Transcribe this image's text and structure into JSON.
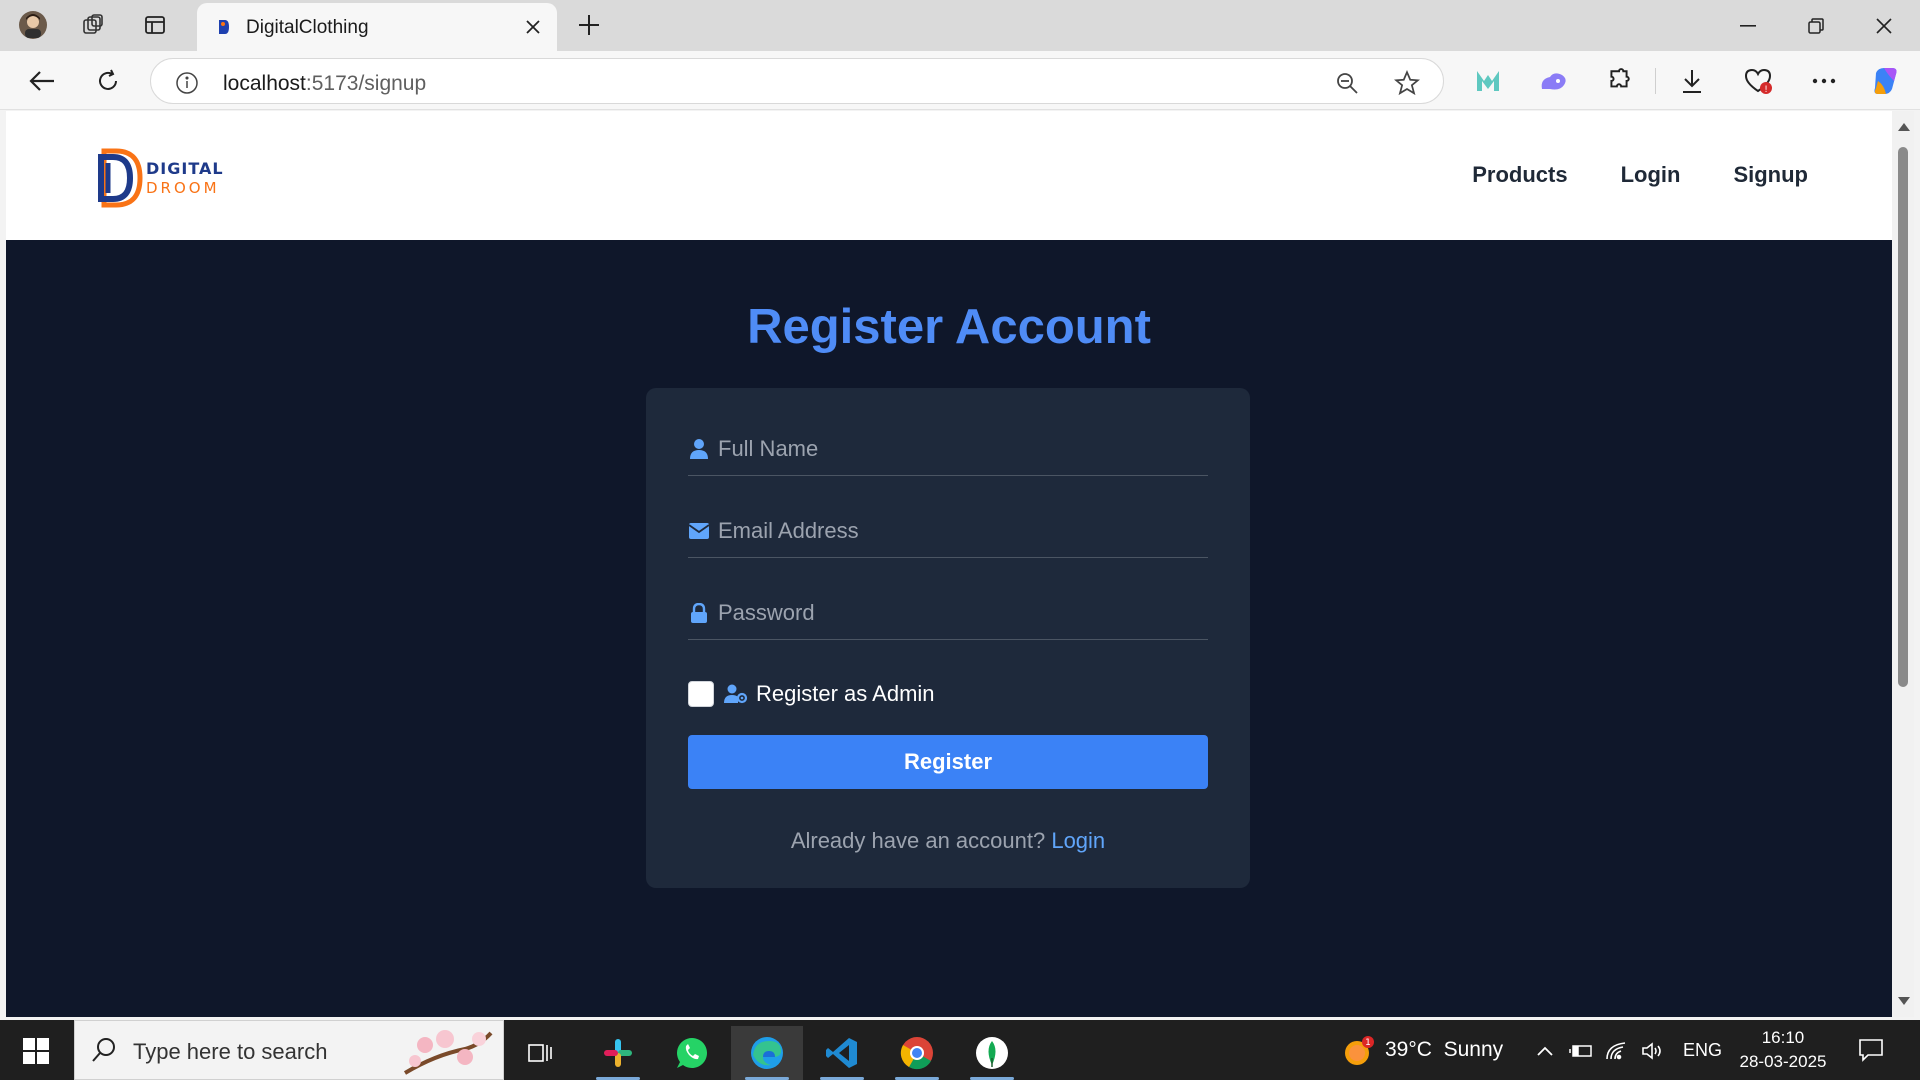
{
  "browser": {
    "tab_title": "DigitalClothing",
    "url_host": "localhost",
    "url_path": ":5173/signup"
  },
  "site": {
    "logo_line1": "DIGITAL",
    "logo_line2": "DROOM",
    "nav": {
      "products": "Products",
      "login": "Login",
      "signup": "Signup"
    }
  },
  "register": {
    "title": "Register Account",
    "full_name_placeholder": "Full Name",
    "email_placeholder": "Email Address",
    "password_placeholder": "Password",
    "admin_label": "Register as Admin",
    "admin_checked": false,
    "submit_label": "Register",
    "footer_text": "Already have an account? ",
    "footer_link": "Login"
  },
  "taskbar": {
    "search_placeholder": "Type here to search",
    "weather": "39°C  Sunny",
    "weather_badge": "1",
    "language": "ENG",
    "time": "16:10",
    "date": "28-03-2025"
  },
  "colors": {
    "page_bg": "#0f172a",
    "card_bg": "#1e293b",
    "accent": "#3b82f6",
    "title": "#4f8cf6"
  }
}
